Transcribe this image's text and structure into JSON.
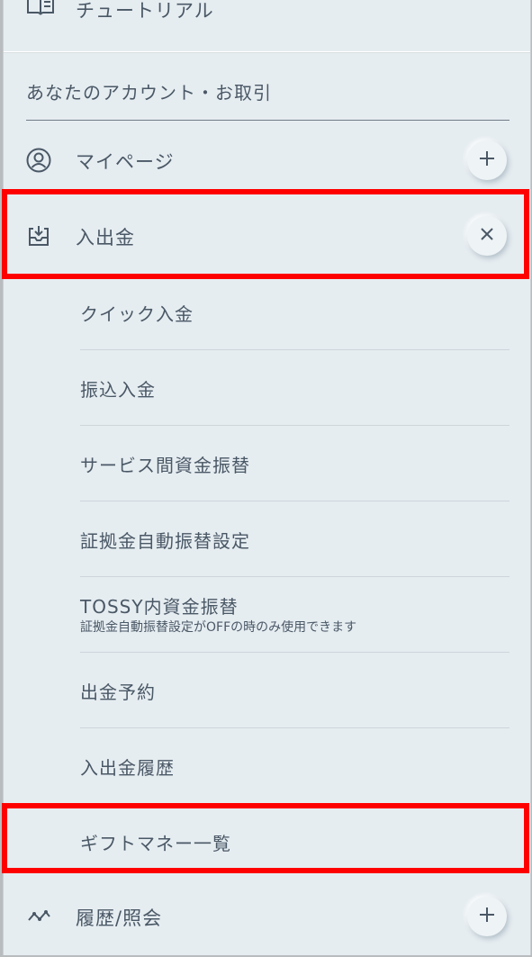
{
  "menu": {
    "tutorial_label": "チュートリアル",
    "section_title": "あなたのアカウント・お取引",
    "mypage_label": "マイページ",
    "deposit_label": "入出金",
    "history_label": "履歴/照会"
  },
  "deposit_submenu": {
    "quick_deposit": "クイック入金",
    "bank_transfer_deposit": "振込入金",
    "service_transfer": "サービス間資金振替",
    "margin_auto_transfer_settings": "証拠金自動振替設定",
    "tossy_transfer": "TOSSY内資金振替",
    "tossy_transfer_note": "証拠金自動振替設定がOFFの時のみ使用できます",
    "withdrawal_reservation": "出金予約",
    "history": "入出金履歴",
    "gift_money_list": "ギフトマネー一覧"
  },
  "icons": {
    "tutorial": "book-icon",
    "mypage": "user-circle-icon",
    "deposit": "inbox-download-icon",
    "history": "line-chart-icon",
    "expand": "plus-icon",
    "collapse": "close-icon"
  },
  "colors": {
    "highlight": "#ff0000",
    "text": "#4a5866",
    "background": "#e6edf1"
  }
}
